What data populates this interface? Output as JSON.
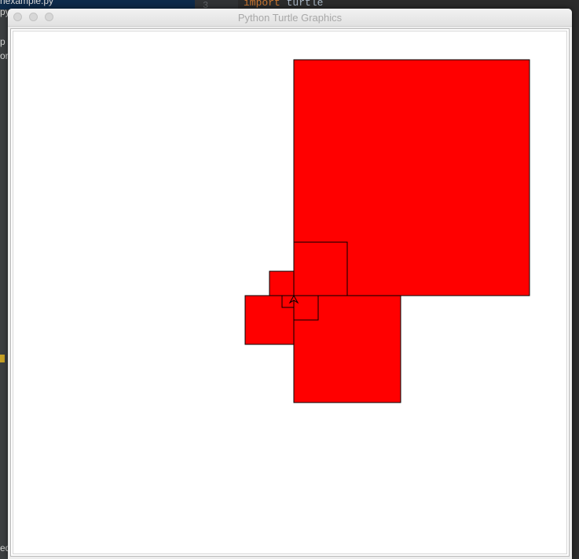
{
  "editor": {
    "sidebar_files": [
      "nexample.py",
      "py",
      "p",
      "or",
      "ed"
    ],
    "gutter_line_number": "3",
    "code": {
      "keyword": "import",
      "module": "turtle"
    }
  },
  "window": {
    "title": "Python Turtle Graphics",
    "controls": [
      "close",
      "minimize",
      "zoom"
    ]
  },
  "canvas": {
    "background": "#ffffff",
    "fill_color": "#ff0000",
    "pen_color": "#000000",
    "turtle_shape": "classic-arrow",
    "shape_count": 6
  },
  "colors": {
    "window_chrome": "#ececec",
    "title_text": "#a8a8a8",
    "editor_bg": "#2b2b2b"
  }
}
